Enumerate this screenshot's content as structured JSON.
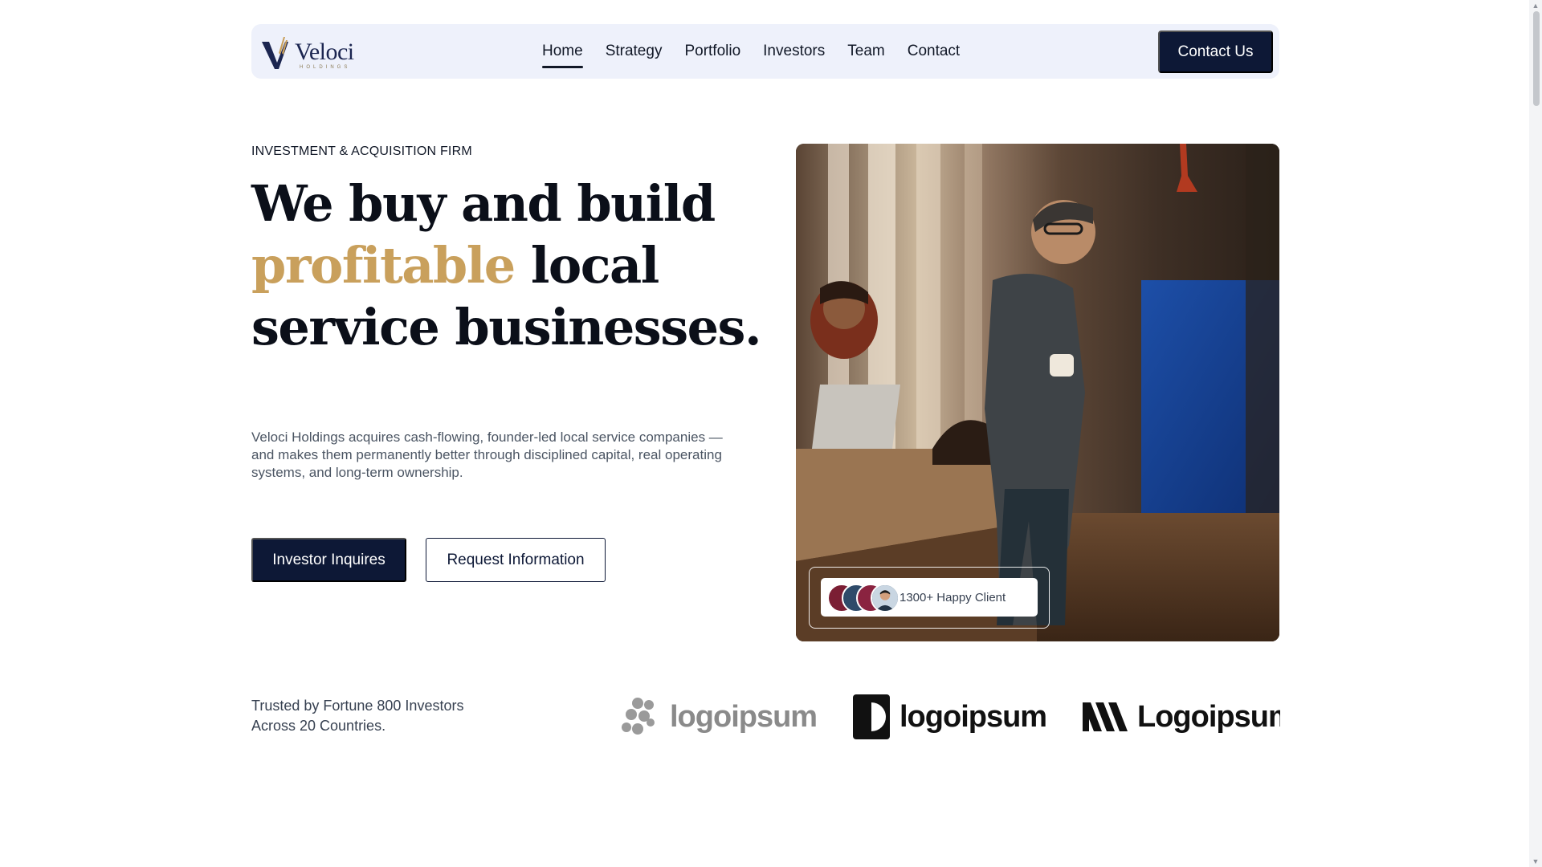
{
  "nav": {
    "logo_name": "Veloci",
    "logo_sub": "HOLDINGS",
    "links": [
      {
        "label": "Home",
        "active": true
      },
      {
        "label": "Strategy",
        "active": false
      },
      {
        "label": "Portfolio",
        "active": false
      },
      {
        "label": "Investors",
        "active": false
      },
      {
        "label": "Team",
        "active": false
      },
      {
        "label": "Contact",
        "active": false
      }
    ],
    "cta_label": "Contact Us"
  },
  "hero": {
    "eyebrow": "INVESTMENT & ACQUISITION FIRM",
    "headline_part1": "We buy and build",
    "headline_accent": "profitable",
    "headline_part2": "local service businesses.",
    "lead": "Veloci Holdings acquires cash-flowing, founder-led local service companies — and makes them permanently better through disciplined capital, real operating systems, and long-term ownership.",
    "primary_button": "Investor Inquires",
    "secondary_button": "Request Information",
    "badge_text": "1300+ Happy Client"
  },
  "trusted": {
    "line1": "Trusted by Fortune 800 Investors",
    "line2": "Across 20 Countries."
  },
  "partner_logos": [
    {
      "name": "logoipsum",
      "icon": "dots-icon",
      "color": "#8a8a8a"
    },
    {
      "name": "logoipsum",
      "icon": "half-circle-icon",
      "color": "#111111"
    },
    {
      "name": "Logoipsum",
      "icon": "stripes-icon",
      "color": "#111111"
    }
  ],
  "colors": {
    "navy": "#0d1836",
    "gold": "#c9a05c",
    "nav_bg": "#eef1fb"
  }
}
